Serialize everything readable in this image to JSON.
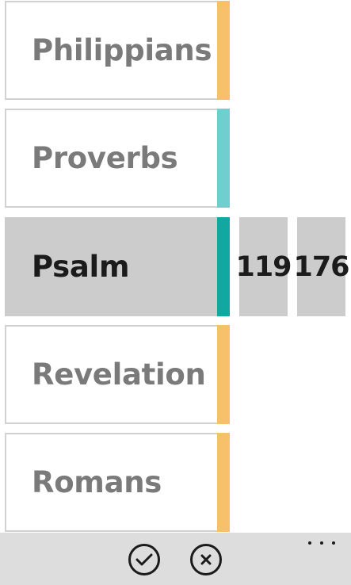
{
  "books": [
    {
      "name": "Philippians",
      "accent": "#f8c06b",
      "selected": false
    },
    {
      "name": "Proverbs",
      "accent": "#6fcfcf",
      "selected": false
    },
    {
      "name": "Psalm",
      "accent": "#12a8a2",
      "selected": true
    },
    {
      "name": "Revelation",
      "accent": "#f8c06b",
      "selected": false
    },
    {
      "name": "Romans",
      "accent": "#f8c06b",
      "selected": false
    }
  ],
  "chapters": [
    "119",
    "176"
  ],
  "app_bar": {
    "buttons": [
      {
        "name": "accept",
        "icon": "check-icon"
      },
      {
        "name": "cancel",
        "icon": "close-icon"
      }
    ],
    "more_icon": "ellipsis-icon"
  },
  "colors": {
    "tile_border": "#d2d2d2",
    "selected_background": "#cccccc",
    "app_bar_background": "#dddddd",
    "dimmed_text": "#7a7a7a",
    "active_text": "#1b1b1b"
  }
}
